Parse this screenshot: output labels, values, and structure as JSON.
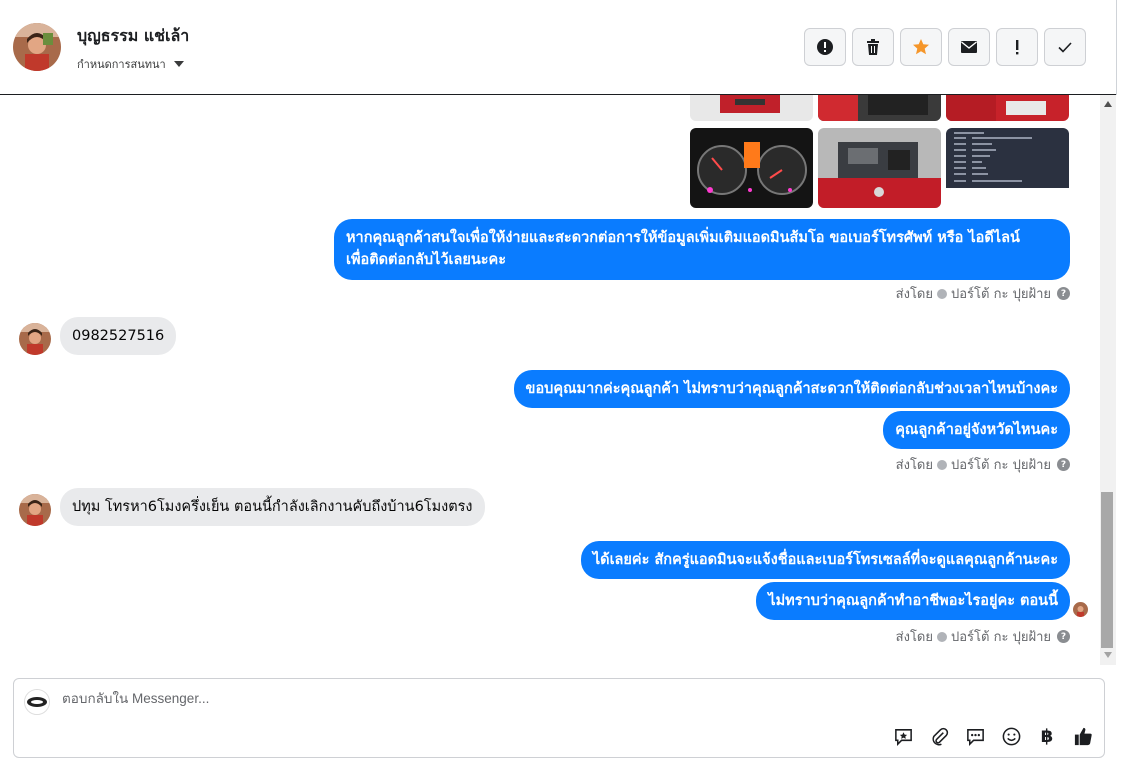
{
  "header": {
    "contact_name": "บุญธรรม แช่เล้า",
    "assign_label": "กำหนดการสนทนา",
    "actions": [
      {
        "name": "report-button",
        "icon": "exclamation-circle-icon"
      },
      {
        "name": "delete-button",
        "icon": "trash-icon"
      },
      {
        "name": "star-button",
        "icon": "star-icon",
        "color": "#f5962a"
      },
      {
        "name": "mark-unread-button",
        "icon": "envelope-icon"
      },
      {
        "name": "important-button",
        "icon": "exclamation-icon"
      },
      {
        "name": "mark-done-button",
        "icon": "check-icon"
      }
    ]
  },
  "messages": [
    {
      "id": "m1",
      "direction": "outgoing",
      "lines": [
        "หากคุณลูกค้าสนใจเพื่อให้ง่ายและสะดวกต่อการให้ข้อมูลเพิ่มเติมแอดมินส้มโอ ขอเบอร์โทรศัพท์ หรือ ไอดีไลน์",
        "เพื่อติดต่อกลับไว้เลยนะคะ"
      ]
    },
    {
      "id": "m2",
      "direction": "incoming",
      "lines": [
        "0982527516"
      ]
    },
    {
      "id": "m3",
      "direction": "outgoing",
      "lines": [
        "ขอบคุณมากค่ะคุณลูกค้า ไม่ทราบว่าคุณลูกค้าสะดวกให้ติดต่อกลับช่วงเวลาไหนบ้างคะ"
      ]
    },
    {
      "id": "m4",
      "direction": "outgoing",
      "lines": [
        "คุณลูกค้าอยู่จังหวัดไหนคะ"
      ]
    },
    {
      "id": "m5",
      "direction": "incoming",
      "lines": [
        "ปทุม โทรหา6โมงครึ่งเย็น ตอนนี้กำลังเลิกงานคับถึงบ้าน6โมงตรง"
      ]
    },
    {
      "id": "m6",
      "direction": "outgoing",
      "lines": [
        "ได้เลยค่ะ สักครู่แอดมินจะแจ้งชื่อและเบอร์โทรเซลล์ที่จะดูแลคุณลูกค้านะคะ"
      ]
    },
    {
      "id": "m7",
      "direction": "outgoing",
      "lines": [
        "ไม่ทราบว่าคุณลูกค้าทำอาชีพอะไรอยู่คะ ตอนนี้"
      ]
    }
  ],
  "sent_by": {
    "prefix": "ส่งโดย",
    "agent": "ปอร์โต้ กะ ปุยฝ้าย",
    "help": "?"
  },
  "composer": {
    "placeholder": "ตอบกลับใน Messenger...",
    "tools": [
      "saved-reply-icon",
      "attachment-icon",
      "chat-bubble-icon",
      "emoji-icon",
      "baht-icon",
      "thumbs-up-icon"
    ],
    "baht_symbol": "฿"
  },
  "colors": {
    "outgoing_bubble": "#0a7cff",
    "incoming_bubble": "#e9eaec",
    "star": "#f5962a"
  }
}
